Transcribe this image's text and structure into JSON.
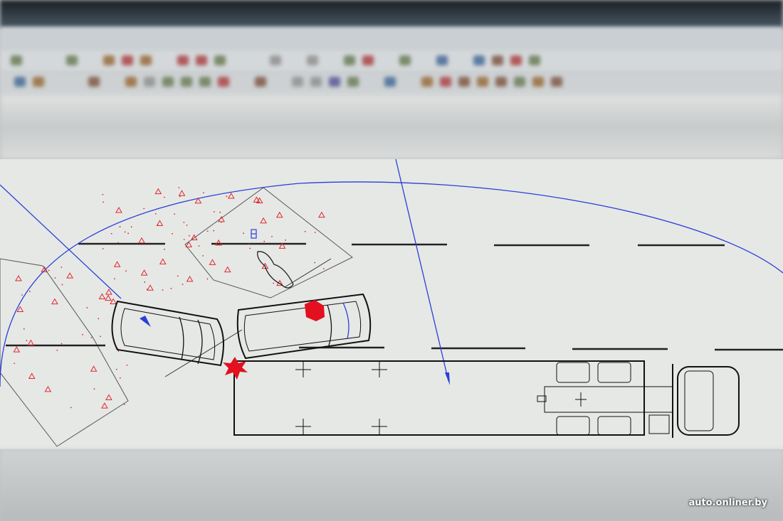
{
  "watermark": "auto.onliner.by",
  "colors": {
    "trajectory": "#2a3fd6",
    "debris": "#e0282a",
    "impact": "#e3101f",
    "outline": "#111111",
    "background": "#e6e8e6"
  },
  "icons": [
    "pedestrian-icon",
    "impact-star-icon",
    "damage-marker-icon",
    "direction-arrow-icon"
  ]
}
